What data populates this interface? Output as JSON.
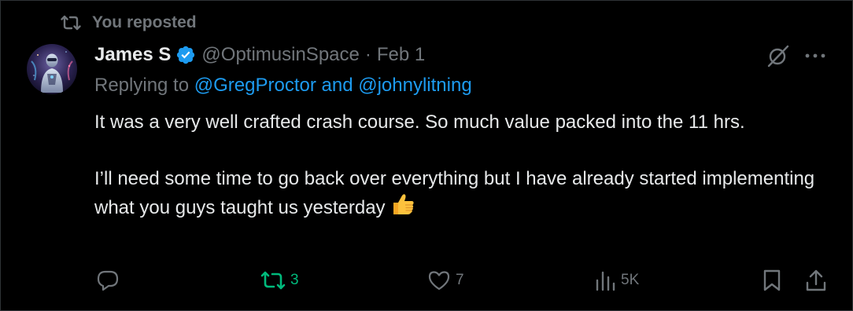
{
  "repost_banner": {
    "label": "You reposted",
    "icon": "repost-icon"
  },
  "post": {
    "author": {
      "display_name": "James S",
      "handle": "@OptimusinSpace",
      "verified": true,
      "verified_color": "#1d9bf0"
    },
    "separator": "·",
    "date": "Feb 1",
    "replying_prefix": "Replying to",
    "replying_to": [
      "@GregProctor",
      "@johnylitning"
    ],
    "replying_joiner": "and",
    "paragraphs": [
      "It was a very well crafted crash course. So much value packed into the 11 hrs.",
      "I’ll need some time to go back over everything but I have already started implementing what you guys taught us yesterday"
    ],
    "trailing_emoji": "thumbs-up"
  },
  "actions": {
    "reply": {
      "icon": "reply-icon",
      "count": ""
    },
    "repost": {
      "icon": "repost-icon",
      "count": "3",
      "active": true,
      "active_color": "#00ba7c"
    },
    "like": {
      "icon": "heart-icon",
      "count": "7"
    },
    "views": {
      "icon": "views-icon",
      "count": "5K"
    },
    "bookmark": {
      "icon": "bookmark-icon"
    },
    "share": {
      "icon": "share-icon"
    }
  },
  "colors": {
    "background": "#000000",
    "text": "#e7e9ea",
    "muted": "#71767b",
    "link": "#1d9bf0"
  }
}
